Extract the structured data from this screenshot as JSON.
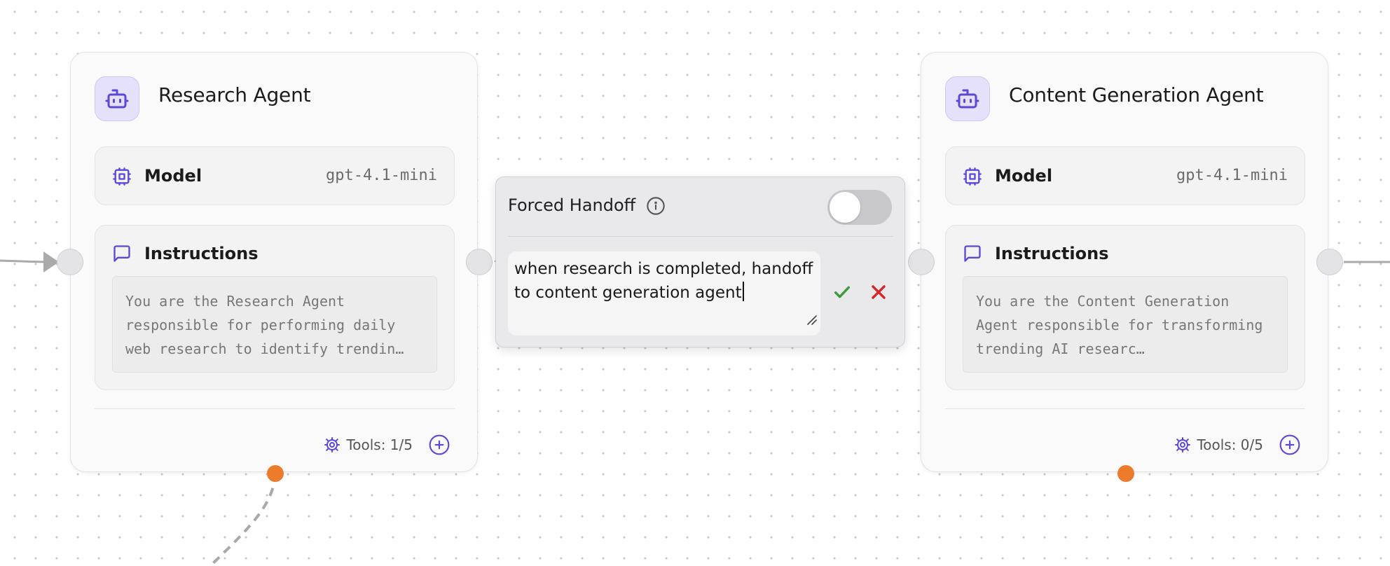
{
  "agents": [
    {
      "title": "Research Agent",
      "model_label": "Model",
      "model_value": "gpt-4.1-mini",
      "instructions_label": "Instructions",
      "instructions_text": "You are the Research Agent responsible for performing daily web research to identify trendin…",
      "tools_text": "Tools: 1/5"
    },
    {
      "title": "Content Generation Agent",
      "model_label": "Model",
      "model_value": "gpt-4.1-mini",
      "instructions_label": "Instructions",
      "instructions_text": "You are the Content Generation Agent responsible for transforming trending AI researc…",
      "tools_text": "Tools: 0/5"
    }
  ],
  "handoff": {
    "title": "Forced Handoff",
    "toggle_on": false,
    "condition_text": "when research is completed, handoff to content generation agent"
  },
  "icons": {
    "avatar": "robot-icon",
    "model": "cpu-chip-icon",
    "instructions": "message-square-icon",
    "tools": "gear-icon",
    "add": "plus-circle-icon",
    "info": "info-icon",
    "confirm": "check-icon",
    "cancel": "close-icon"
  },
  "colors": {
    "accent": "#5b48d9",
    "handle_orange": "#ed7b2c",
    "confirm_green": "#3d9a3d",
    "cancel_red": "#d62828"
  }
}
